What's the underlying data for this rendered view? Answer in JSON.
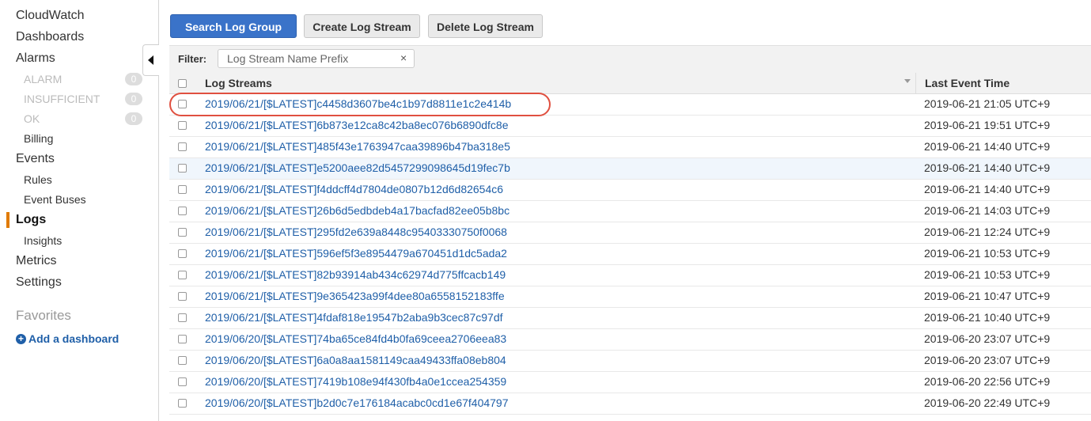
{
  "sidebar": {
    "items": [
      {
        "label": "CloudWatch"
      },
      {
        "label": "Dashboards"
      },
      {
        "label": "Alarms"
      },
      {
        "label": "ALARM",
        "count": "0"
      },
      {
        "label": "INSUFFICIENT",
        "count": "0"
      },
      {
        "label": "OK",
        "count": "0"
      },
      {
        "label": "Billing"
      },
      {
        "label": "Events"
      },
      {
        "label": "Rules"
      },
      {
        "label": "Event Buses"
      },
      {
        "label": "Logs"
      },
      {
        "label": "Insights"
      },
      {
        "label": "Metrics"
      },
      {
        "label": "Settings"
      }
    ],
    "favorites_title": "Favorites",
    "add_dashboard": "Add a dashboard"
  },
  "toolbar": {
    "search_log_group": "Search Log Group",
    "create_log_stream": "Create Log Stream",
    "delete_log_stream": "Delete Log Stream"
  },
  "filter": {
    "label": "Filter:",
    "placeholder": "Log Stream Name Prefix",
    "clear": "×"
  },
  "table": {
    "headers": {
      "stream": "Log Streams",
      "time": "Last Event Time"
    },
    "rows": [
      {
        "stream": "2019/06/21/[$LATEST]c4458d3607be4c1b97d8811e1c2e414b",
        "time": "2019-06-21 21:05 UTC+9"
      },
      {
        "stream": "2019/06/21/[$LATEST]6b873e12ca8c42ba8ec076b6890dfc8e",
        "time": "2019-06-21 19:51 UTC+9"
      },
      {
        "stream": "2019/06/21/[$LATEST]485f43e1763947caa39896b47ba318e5",
        "time": "2019-06-21 14:40 UTC+9"
      },
      {
        "stream": "2019/06/21/[$LATEST]e5200aee82d5457299098645d19fec7b",
        "time": "2019-06-21 14:40 UTC+9"
      },
      {
        "stream": "2019/06/21/[$LATEST]f4ddcff4d7804de0807b12d6d82654c6",
        "time": "2019-06-21 14:40 UTC+9"
      },
      {
        "stream": "2019/06/21/[$LATEST]26b6d5edbdeb4a17bacfad82ee05b8bc",
        "time": "2019-06-21 14:03 UTC+9"
      },
      {
        "stream": "2019/06/21/[$LATEST]295fd2e639a8448c95403330750f0068",
        "time": "2019-06-21 12:24 UTC+9"
      },
      {
        "stream": "2019/06/21/[$LATEST]596ef5f3e8954479a670451d1dc5ada2",
        "time": "2019-06-21 10:53 UTC+9"
      },
      {
        "stream": "2019/06/21/[$LATEST]82b93914ab434c62974d775ffcacb149",
        "time": "2019-06-21 10:53 UTC+9"
      },
      {
        "stream": "2019/06/21/[$LATEST]9e365423a99f4dee80a6558152183ffe",
        "time": "2019-06-21 10:47 UTC+9"
      },
      {
        "stream": "2019/06/21/[$LATEST]4fdaf818e19547b2aba9b3cec87c97df",
        "time": "2019-06-21 10:40 UTC+9"
      },
      {
        "stream": "2019/06/20/[$LATEST]74ba65ce84fd4b0fa69ceea2706eea83",
        "time": "2019-06-20 23:07 UTC+9"
      },
      {
        "stream": "2019/06/20/[$LATEST]6a0a8aa1581149caa49433ffa08eb804",
        "time": "2019-06-20 23:07 UTC+9"
      },
      {
        "stream": "2019/06/20/[$LATEST]7419b108e94f430fb4a0e1ccea254359",
        "time": "2019-06-20 22:56 UTC+9"
      },
      {
        "stream": "2019/06/20/[$LATEST]b2d0c7e176184acabc0cd1e67f404797",
        "time": "2019-06-20 22:49 UTC+9"
      }
    ]
  },
  "colors": {
    "primary": "#3a73c9",
    "link": "#1f5fa8",
    "active_indicator": "#e07b00",
    "highlight_circle": "#e05040"
  }
}
